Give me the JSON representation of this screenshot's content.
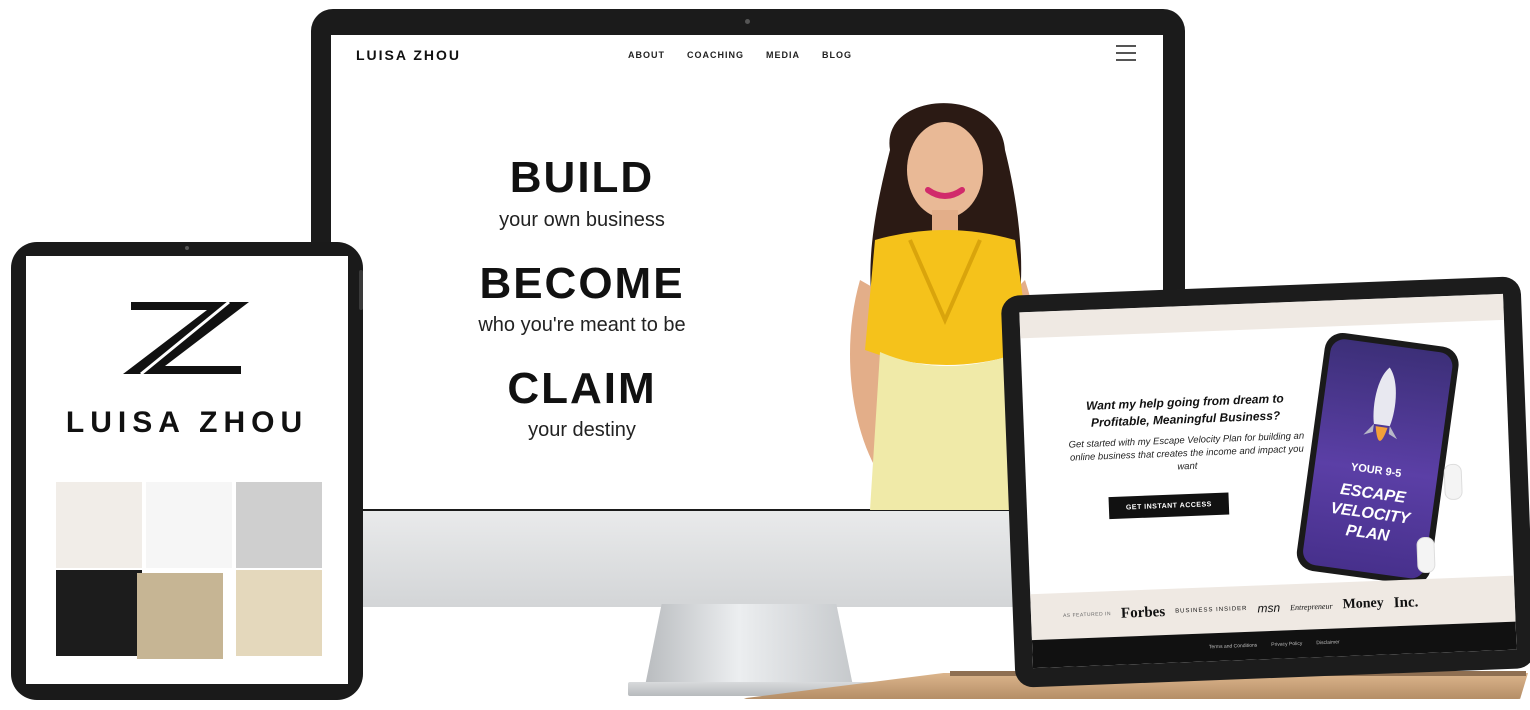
{
  "desktop_site": {
    "logo": "LUISA ZHOU",
    "nav": [
      "ABOUT",
      "COACHING",
      "MEDIA",
      "BLOG"
    ],
    "hero": [
      {
        "big": "BUILD",
        "small": "your own business"
      },
      {
        "big": "BECOME",
        "small": "who you're meant to be"
      },
      {
        "big": "CLAIM",
        "small": "your destiny"
      }
    ]
  },
  "tablet": {
    "brand": "LUISA ZHOU",
    "swatches": [
      "#f1ede8",
      "#f6f6f6",
      "#cfcfcf",
      "#1c1c1c",
      "#c6b594",
      "#e4d8bc"
    ]
  },
  "laptop_site": {
    "headline": "Want my help going from dream to Profitable, Meaningful Business?",
    "body": "Get started with my Escape Velocity Plan for building an online business that creates the income and impact you want",
    "cta": "GET INSTANT ACCESS",
    "phone": {
      "small": "YOUR 9-5",
      "big": "ESCAPE VELOCITY PLAN"
    },
    "featured_label": "AS FEATURED IN",
    "press": [
      "Forbes",
      "BUSINESS INSIDER",
      "msn",
      "Entrepreneur",
      "Money",
      "Inc."
    ],
    "footer": [
      "Terms and Conditions",
      "Privacy Policy",
      "Disclaimer"
    ]
  },
  "colors": {
    "accent_yellow": "#f5c21b",
    "phone_purple": "#4b3393",
    "beige": "#efe9e3"
  }
}
